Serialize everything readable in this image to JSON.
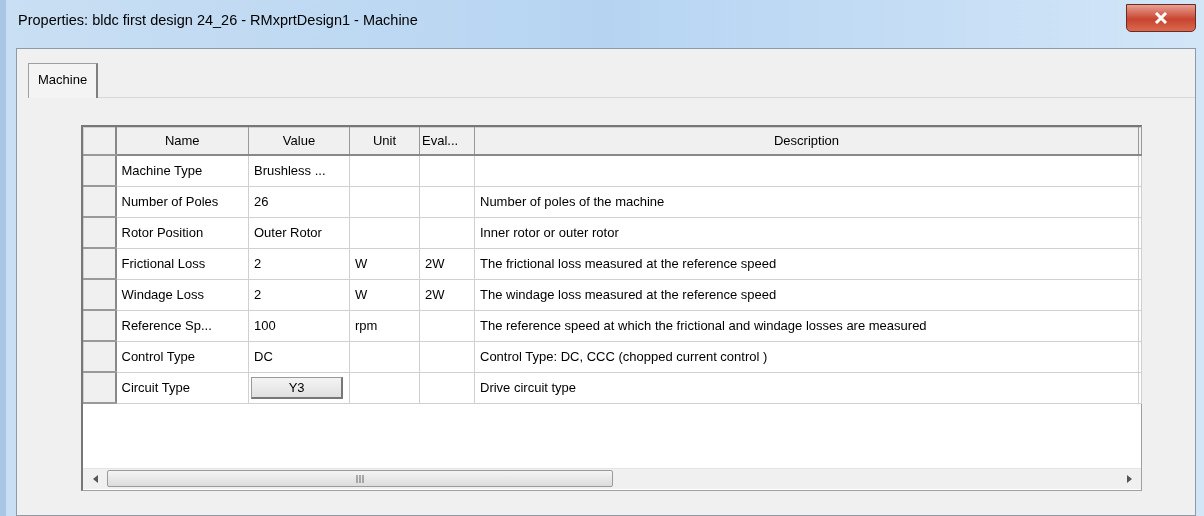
{
  "window": {
    "title": "Properties: bldc first design 24_26 - RMxprtDesign1 - Machine"
  },
  "tabs": [
    {
      "label": "Machine",
      "selected": true
    }
  ],
  "table": {
    "columns": [
      "Name",
      "Value",
      "Unit",
      "Eval...",
      "Description"
    ],
    "rows": [
      {
        "kind": "text",
        "name": "Machine Type",
        "value": "Brushless ..."
      },
      {
        "kind": "text",
        "name": "Number of Poles",
        "value": "26",
        "description": "Number of poles of the machine"
      },
      {
        "kind": "text",
        "name": "Rotor Position",
        "value": "Outer Rotor",
        "description": "Inner rotor or outer rotor"
      },
      {
        "kind": "text",
        "name": "Frictional Loss",
        "value": "2",
        "unit": "W",
        "eval": "2W",
        "description": "The frictional loss measured at the reference speed"
      },
      {
        "kind": "text",
        "name": "Windage Loss",
        "value": "2",
        "unit": "W",
        "eval": "2W",
        "description": "The windage loss measured at the reference speed"
      },
      {
        "kind": "text",
        "name": "Reference Sp...",
        "value": "100",
        "unit": "rpm",
        "description": "The reference speed at which the frictional and windage losses are measured"
      },
      {
        "kind": "text",
        "name": "Control Type",
        "value": "DC",
        "description": "Control Type: DC, CCC (chopped current control )"
      },
      {
        "kind": "button",
        "name": "Circuit Type",
        "value": "Y3",
        "description": "Drive circuit type"
      }
    ]
  }
}
